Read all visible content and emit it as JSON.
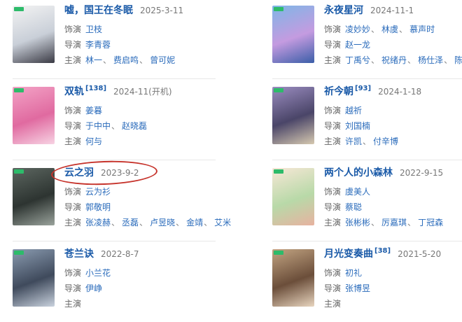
{
  "labels": {
    "cast": "饰演",
    "director": "导演",
    "starring": "主演"
  },
  "items": [
    {
      "title": "嘘，国王在冬眠",
      "sup": "",
      "date": "2025-3-11",
      "cast": [
        "卫枝"
      ],
      "director": [
        "李青蓉"
      ],
      "starring": [
        "林一",
        "费启鸣",
        "曾可妮"
      ],
      "poster_colors": [
        "#f3f3f3",
        "#c9cfd8",
        "#3a3a44"
      ]
    },
    {
      "title": "永夜星河",
      "sup": "",
      "date": "2024-11-1",
      "cast": [
        "凌妙妙",
        "林虞",
        "慕声时"
      ],
      "director": [
        "赵一龙"
      ],
      "starring": [
        "丁禹兮",
        "祝绪丹",
        "杨仕泽",
        "陈都灵"
      ],
      "poster_colors": [
        "#7fb6e6",
        "#c49be0",
        "#3b5ea8"
      ]
    },
    {
      "title": "双轨",
      "sup": "[138]",
      "date": "2024-11(开机)",
      "cast": [
        "姜暮"
      ],
      "director": [
        "于中中",
        "赵晓磊"
      ],
      "starring": [
        "何与"
      ],
      "poster_colors": [
        "#f3a3c6",
        "#e06aa0",
        "#f7d3e3"
      ]
    },
    {
      "title": "祈今朝",
      "sup": "[93]",
      "date": "2024-1-18",
      "cast": [
        "越祈"
      ],
      "director": [
        "刘国楠"
      ],
      "starring": [
        "许凯",
        "付辛博"
      ],
      "poster_colors": [
        "#9a8cc0",
        "#4a4568",
        "#d6c9b0"
      ]
    },
    {
      "title": "云之羽",
      "sup": "",
      "date": "2023-9-2",
      "cast": [
        "云为衫"
      ],
      "director": [
        "郭敬明"
      ],
      "starring": [
        "张凌赫",
        "丞磊",
        "卢昱晓",
        "金靖",
        "艾米"
      ],
      "poster_colors": [
        "#5c6660",
        "#2d3431",
        "#9aa39c"
      ]
    },
    {
      "title": "两个人的小森林",
      "sup": "",
      "date": "2022-9-15",
      "cast": [
        "虞美人"
      ],
      "director": [
        "蔡聪"
      ],
      "starring": [
        "张彬彬",
        "厉嘉琪",
        "丁冠森"
      ],
      "poster_colors": [
        "#f7e7d6",
        "#b8d9a8",
        "#e7b2a0"
      ]
    },
    {
      "title": "苍兰诀",
      "sup": "",
      "date": "2022-8-7",
      "cast": [
        "小兰花"
      ],
      "director": [
        "伊峥"
      ],
      "starring": [],
      "poster_colors": [
        "#8a9bb0",
        "#3f4a5c",
        "#c9d2de"
      ]
    },
    {
      "title": "月光变奏曲",
      "sup": "[38]",
      "date": "2021-5-20",
      "cast": [
        "初礼"
      ],
      "director": [
        "张博昱"
      ],
      "starring": [],
      "poster_colors": [
        "#c2a482",
        "#6b4e3a",
        "#e8d5bf"
      ]
    }
  ]
}
